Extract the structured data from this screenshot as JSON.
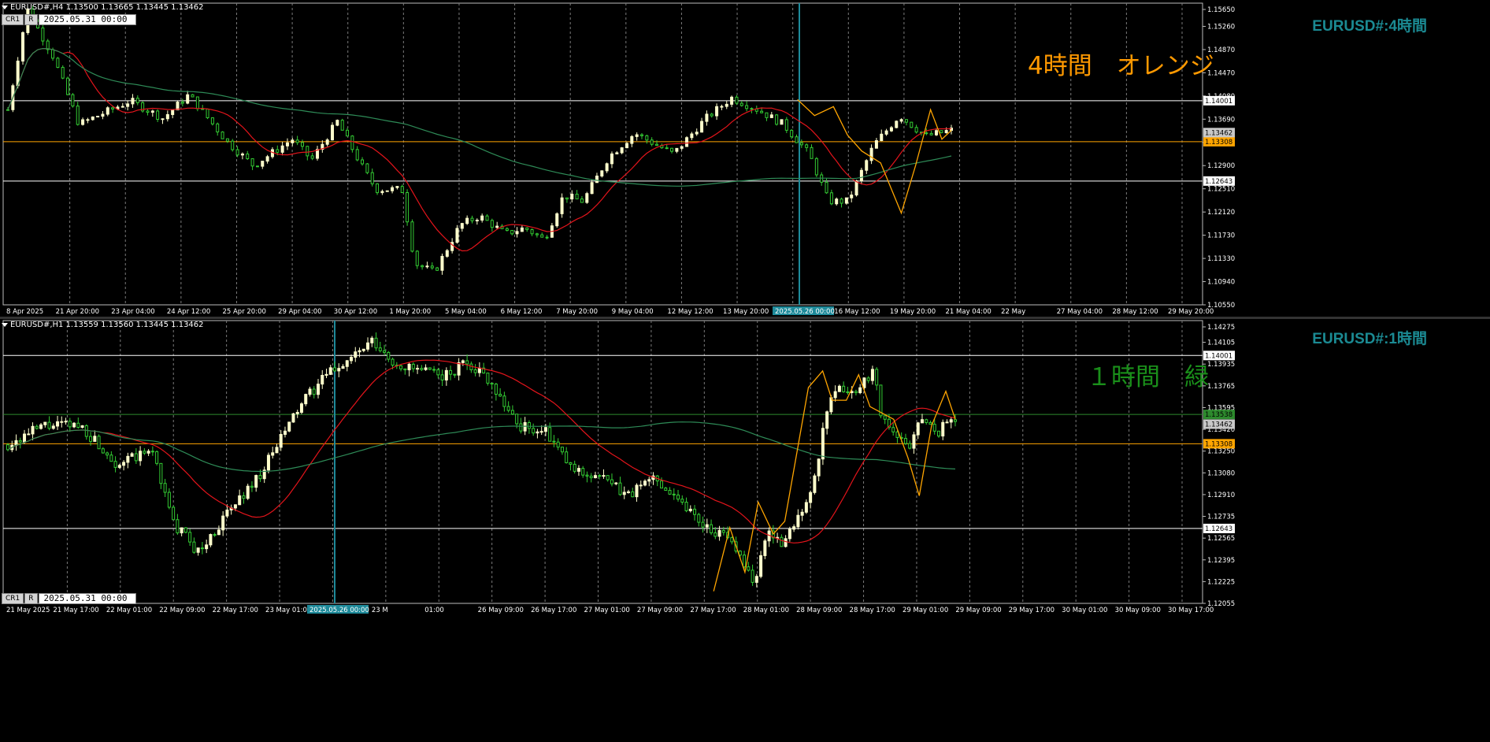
{
  "colors": {
    "background": "#000000",
    "grid": "#7a7a7a",
    "bull_candle": "#ffffcc",
    "bear_candle": "#33cc33",
    "ma_fast": "#e3141b",
    "ma_slow": "#2e8b57",
    "hline_white": "#ffffff",
    "hline_orange": "#ffa500",
    "hline_green": "#2d8a2d",
    "vline_teal": "#1e8a9a",
    "zigzag": "#ffa500",
    "title_teal": "#1b8a93",
    "label_orange": "#ff9900",
    "label_green": "#1a8f1a"
  },
  "top": {
    "header": "EURUSD#,H4  1.13500 1.13665 1.13445 1.13462",
    "btn_cr": "CR1",
    "btn_r": "R",
    "date_field": "2025.05.31 00:00",
    "pair_title": "EURUSD#:4時間",
    "big_label": "4時間　オレンジ",
    "price_labels": [
      "1.15650",
      "1.15260",
      "1.14870",
      "1.14470",
      "1.14080",
      "1.13690",
      "1.13290",
      "1.12900",
      "1.12510",
      "1.12120",
      "1.11730",
      "1.11330",
      "1.10940",
      "1.10550"
    ],
    "marked_prices": {
      "white_upper": "1.14001",
      "current": "1.13462",
      "orange": "1.13308",
      "white_lower": "1.12643"
    },
    "time_labels": [
      "8 Apr 2025",
      "21 Apr 20:00",
      "23 Apr 04:00",
      "24 Apr 12:00",
      "25 Apr 20:00",
      "29 Apr 04:00",
      "30 Apr 12:00",
      "1 May 20:00",
      "5 May 04:00",
      "6 May 12:00",
      "7 May 20:00",
      "9 May 04:00",
      "12 May 12:00",
      "13 May 20:00",
      "15 May 04:00",
      "16 May 12:00",
      "19 May 20:00",
      "21 May 04:00",
      "22 May",
      "27 May 04:00",
      "28 May 12:00",
      "29 May 20:00"
    ],
    "highlight_time": "2025.05.26 00:00"
  },
  "bottom": {
    "header": "EURUSD#,H1  1.13559 1.13560 1.13445 1.13462",
    "btn_cr": "CR1",
    "btn_r": "R",
    "date_field": "2025.05.31 00:00",
    "pair_title": "EURUSD#:1時間",
    "big_label": "１時間　緑",
    "price_labels": [
      "1.14275",
      "1.14105",
      "1.13935",
      "1.13765",
      "1.13595",
      "1.13420",
      "1.13250",
      "1.13080",
      "1.12910",
      "1.12735",
      "1.12565",
      "1.12395",
      "1.12225",
      "1.12055"
    ],
    "marked_prices": {
      "white_upper": "1.14001",
      "green": "1.13538",
      "current": "1.13462",
      "orange": "1.13308",
      "white_lower": "1.12643"
    },
    "time_labels": [
      "21 May 2025",
      "21 May 17:00",
      "22 May 01:00",
      "22 May 09:00",
      "22 May 17:00",
      "23 May 01:00",
      "23 May 09:00",
      "23 M",
      "01:00",
      "26 May 09:00",
      "26 May 17:00",
      "27 May 01:00",
      "27 May 09:00",
      "27 May 17:00",
      "28 May 01:00",
      "28 May 09:00",
      "28 May 17:00",
      "29 May 01:00",
      "29 May 09:00",
      "29 May 17:00",
      "30 May 01:00",
      "30 May 09:00",
      "30 May 17:00"
    ],
    "highlight_time": "2025.05.26 00:00"
  }
}
